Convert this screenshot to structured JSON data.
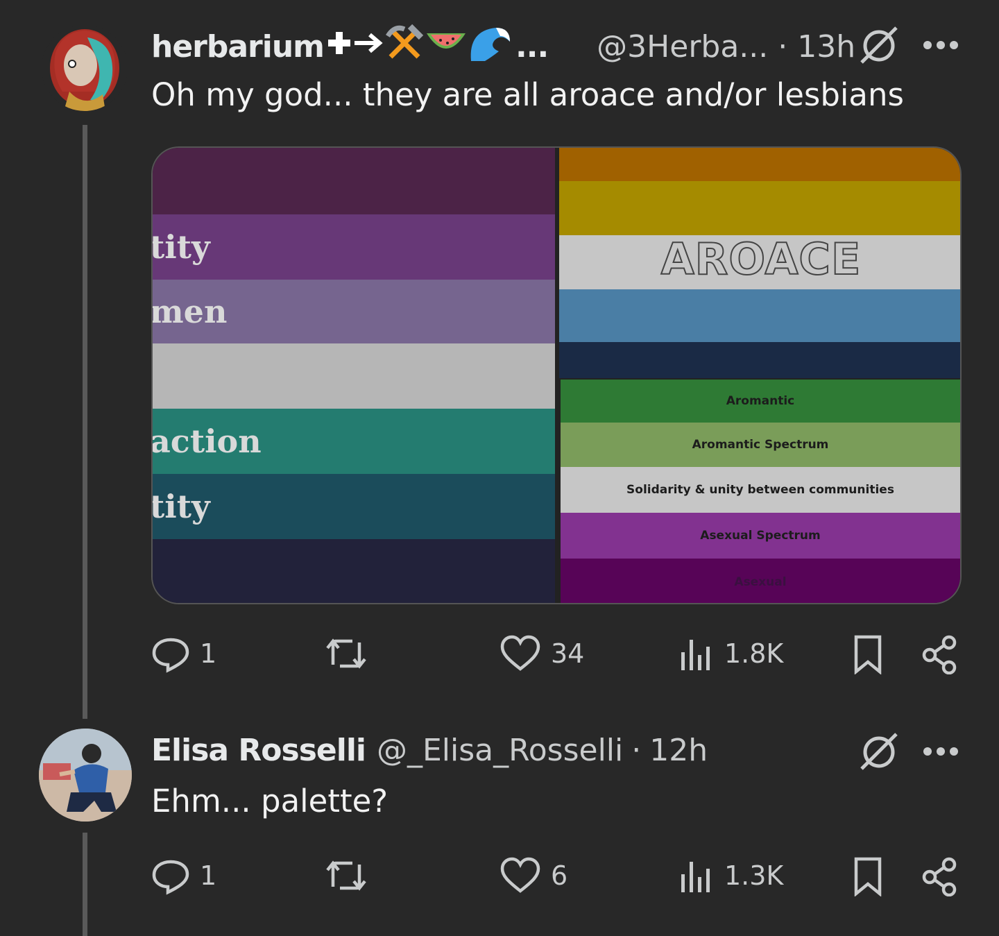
{
  "post1": {
    "display_name": "herbarium",
    "name_emojis": [
      "✚",
      "→",
      "⚒",
      "🍉",
      "🌊"
    ],
    "ellipsis": "...",
    "handle": "@3Herba...",
    "separator": "·",
    "time": "13h",
    "text": "Oh my god... they are all aroace and/or lesbians",
    "media": {
      "left_labels": [
        "tity",
        "men",
        "action",
        "tity"
      ],
      "right_top_label": "AROACE",
      "right_bottom_labels": [
        "Aromantic",
        "Aromantic Spectrum",
        "Solidarity & unity between communities",
        "Asexual Spectrum",
        "Asexual"
      ]
    },
    "stats": {
      "replies": "1",
      "likes": "34",
      "views": "1.8K"
    }
  },
  "post2": {
    "display_name": "Elisa Rosselli",
    "handle": "@_Elisa_Rosselli",
    "separator": "·",
    "time": "12h",
    "text": "Ehm... palette?",
    "stats": {
      "replies": "1",
      "likes": "6",
      "views": "1.3K"
    }
  },
  "icons": {
    "grok": "slashed-circle-icon",
    "more": "more-dots-icon",
    "reply": "reply-bubble-icon",
    "repost": "repost-icon",
    "like": "heart-icon",
    "views": "views-bars-icon",
    "bookmark": "bookmark-icon",
    "share": "share-icon"
  },
  "colors": {
    "background": "#282828",
    "text": "#e7e9ea",
    "muted": "#c9cbcc",
    "thread_line": "#5a5a5a"
  }
}
